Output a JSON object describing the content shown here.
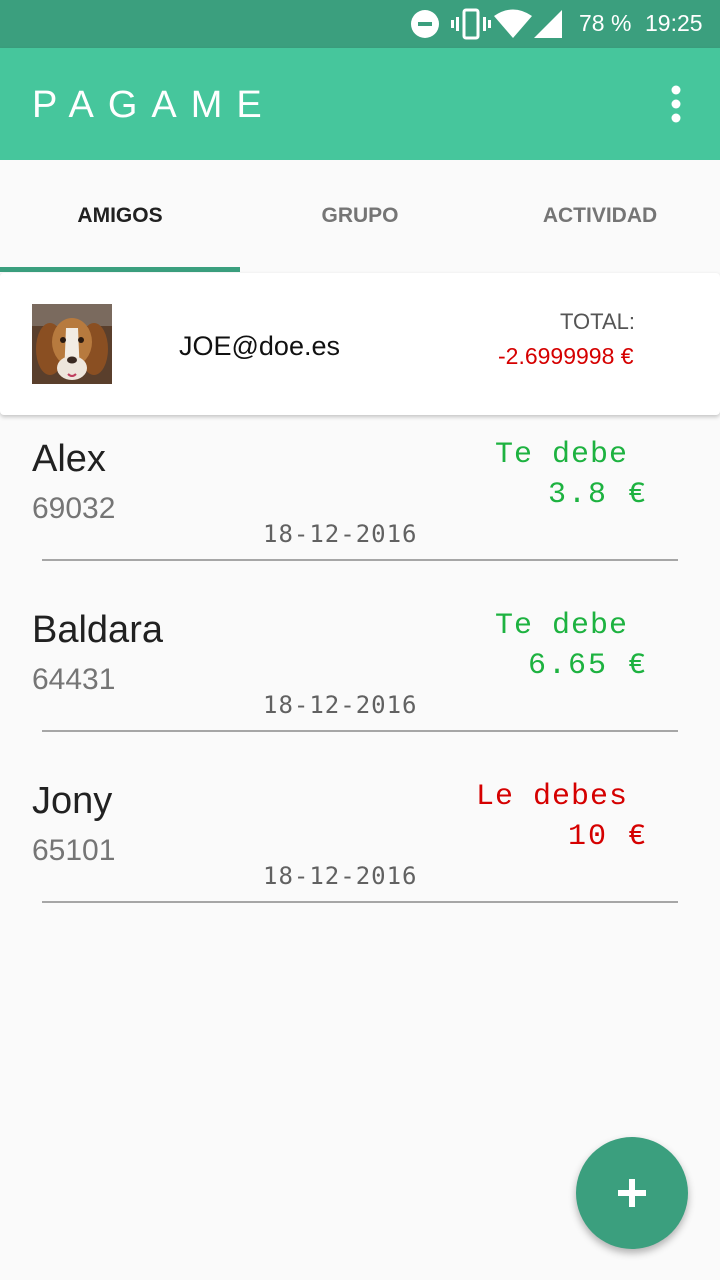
{
  "status_bar": {
    "battery": "78 %",
    "time": "19:25",
    "icons": [
      "do-not-disturb-icon",
      "vibrate-icon",
      "wifi-icon",
      "signal-icon"
    ]
  },
  "app_bar": {
    "title": "PAGAME",
    "menu_icon": "overflow-menu-icon"
  },
  "tabs": [
    {
      "label": "AMIGOS",
      "active": true
    },
    {
      "label": "GRUPO",
      "active": false
    },
    {
      "label": "ACTIVIDAD",
      "active": false
    }
  ],
  "user": {
    "email": "JOE@doe.es",
    "total_label": "TOTAL:",
    "total_value": "-2.6999998 €"
  },
  "friends": [
    {
      "name": "Alex",
      "phone": "69032",
      "date": "18-12-2016",
      "status": "Te debe",
      "amount": "3.8 €",
      "color": "#1db240"
    },
    {
      "name": "Baldara",
      "phone": "64431",
      "date": "18-12-2016",
      "status": "Te debe",
      "amount": "6.65 €",
      "color": "#1db240"
    },
    {
      "name": "Jony",
      "phone": "65101",
      "date": "18-12-2016",
      "status": "Le debes",
      "amount": "10 €",
      "color": "#d50000"
    }
  ],
  "fab": {
    "icon": "add-icon"
  },
  "colors": {
    "status_bar": "#3b9f7e",
    "app_bar": "#46c69c",
    "accent": "#3b9f7e",
    "owed_to_you": "#1db240",
    "you_owe": "#d50000"
  }
}
